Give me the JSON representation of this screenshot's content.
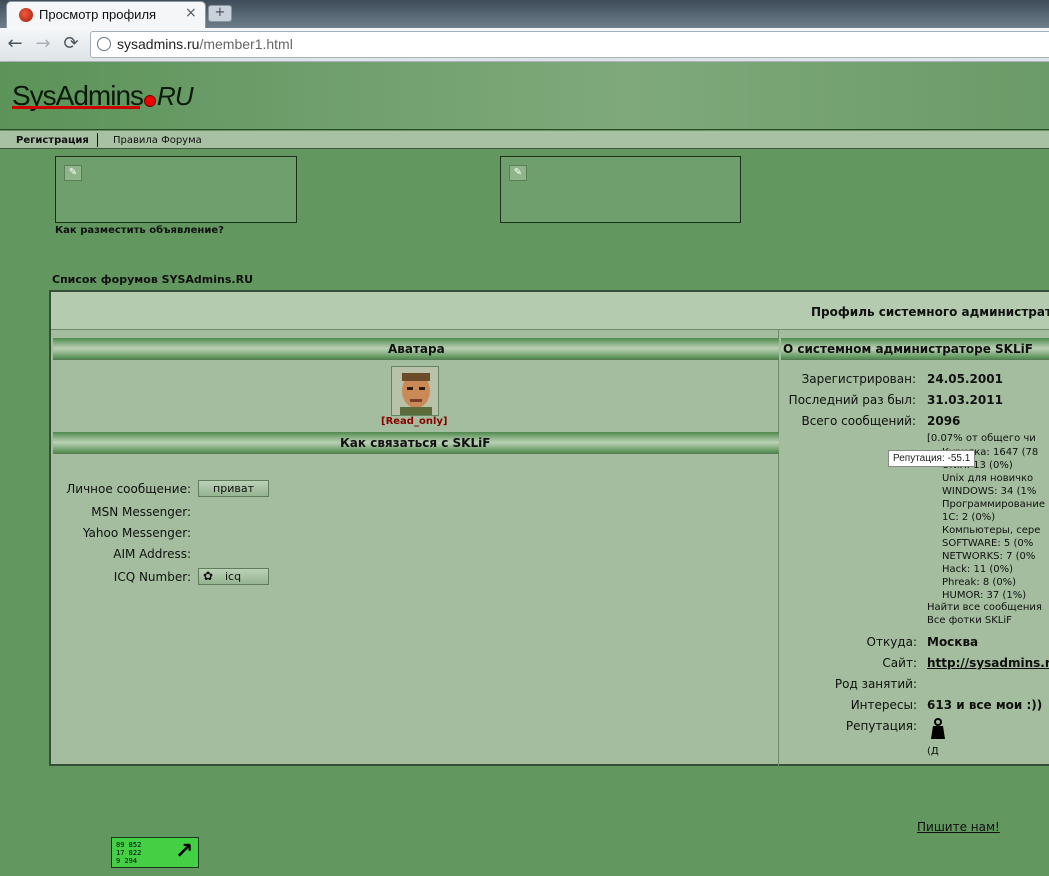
{
  "browser": {
    "tab_title": "Просмотр профиля",
    "tab_close": "×",
    "new_tab": "+",
    "url_host": "sysadmins.ru",
    "url_path": "/member1.html",
    "back": "←",
    "forward": "→",
    "reload": "⟳"
  },
  "site": {
    "logo_main": "SysAdmins",
    "logo_ru": "RU"
  },
  "menu": {
    "register": "Регистрация",
    "rules": "Правила Форума"
  },
  "ads": {
    "how_to": "Как разместить объявление?"
  },
  "forum_list": "Список форумов SYSAdmins.RU",
  "profile": {
    "title": "Профиль системного администратора",
    "avatar_header": "Аватара",
    "about_header": "О системном администраторе SKLiF",
    "read_only": "[Read_only]",
    "contact_header": "Как связаться с SKLiF",
    "contacts": [
      {
        "label": "Личное сообщение:",
        "button": "приват"
      },
      {
        "label": "MSN Messenger:",
        "button": ""
      },
      {
        "label": "Yahoo Messenger:",
        "button": ""
      },
      {
        "label": "AIM Address:",
        "button": ""
      },
      {
        "label": "ICQ Number:",
        "button": "icq"
      }
    ],
    "registered_label": "Зарегистрирован:",
    "registered": "24.05.2001",
    "last_visit_label": "Последний раз был:",
    "last_visit": "31.03.2011",
    "posts_label": "Всего сообщений:",
    "posts": "2096",
    "posts_share": "[0.07% от общего чи",
    "forums": [
      "Курилка: 1647 (78",
      "UNIX: 13 (0%)",
      "Unix для новичко",
      "WINDOWS: 34 (1%",
      "Программирование",
      "1C: 2 (0%)",
      "Компьютеры, сере",
      "SOFTWARE: 5 (0%",
      "NETWORKS: 7 (0%",
      "Hack: 11 (0%)",
      "Phreak: 8 (0%)",
      "HUMOR: 37 (1%)"
    ],
    "find_all": "Найти все сообщения",
    "all_photos": "Все фотки SKLiF",
    "from_label": "Откуда:",
    "from": "Москва",
    "site_label": "Сайт:",
    "site": "http://sysadmins.r",
    "occupation_label": "Род занятий:",
    "interests_label": "Интересы:",
    "interests": "613 и все мои :))",
    "reputation_label": "Репутация:",
    "reputation_tip": "Репутация: -55.1",
    "reputation_note": "(Д"
  },
  "footer": {
    "write_us": "Пишите нам!",
    "counter_lines": [
      "89 852",
      "17 822",
      "9 294"
    ],
    "counter_arrow": "↗"
  }
}
